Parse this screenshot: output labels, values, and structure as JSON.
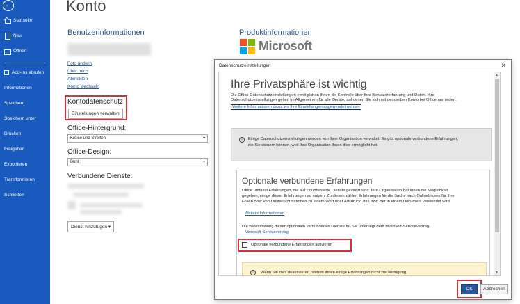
{
  "sidebar": {
    "items": [
      {
        "label": "Startseite",
        "icon": "home-icon"
      },
      {
        "label": "Neu",
        "icon": "new-document-icon"
      },
      {
        "label": "Öffnen",
        "icon": "open-folder-icon"
      },
      {
        "label": "Add-Ins abrufen"
      },
      {
        "label": "Informationen"
      },
      {
        "label": "Speichern"
      },
      {
        "label": "Speichern unter"
      },
      {
        "label": "Drucken"
      },
      {
        "label": "Freigeben"
      },
      {
        "label": "Exportieren"
      },
      {
        "label": "Transformieren"
      },
      {
        "label": "Schließen"
      }
    ],
    "back_icon": "←"
  },
  "page": {
    "title": "Konto",
    "user_info_heading": "Benutzerinformationen",
    "links": [
      "Foto ändern",
      "Über mich",
      "Abmelden",
      "Konto wechseln"
    ],
    "privacy_heading": "Kontodatenschutz",
    "manage_settings_btn": "Einstellungen verwalten",
    "background_label": "Office-Hintergrund:",
    "background_value": "Kreise und Streifen",
    "design_label": "Office-Design:",
    "design_value": "Bunt",
    "services_label": "Verbundene Dienste:",
    "add_service_btn": "Dienst hinzufügen",
    "product_heading": "Produktinformationen",
    "microsoft_word": "Microsoft"
  },
  "colors": {
    "sidebar": "#185abd",
    "accent": "#2b579a",
    "highlight": "#d13438",
    "ms_red": "#f25022",
    "ms_green": "#7fba00",
    "ms_blue": "#00a4ef",
    "ms_yellow": "#ffb900"
  },
  "dialog": {
    "title": "Datenschutzeinstellungen",
    "close": "✕",
    "heading": "Ihre Privatsphäre ist wichtig",
    "intro_line1": "Die Office-Datenschutzeinstellungen ermöglichen Ihnen die Kontrolle über Ihre Benutzererfahrung und Daten. Ihre",
    "intro_line2": "Datenschutzeinstellungen gelten im Allgemeinen für alle Geräte, auf denen Sie sich mit demselben Konto bei Office anmelden.",
    "more_info_link": "Weitere Informationen dazu, wo Ihre Einstellungen angewendet werden",
    "info_line1": "Einige Datenschutzeinstellungen werden von Ihrer Organisation verwaltet. Es gibt optionale verbundene Erfahrungen,",
    "info_line2": "die Sie steuern können, weil Ihre Organisation Ihnen dies ermöglicht hat.",
    "optional_heading": "Optionale verbundene Erfahrungen",
    "opt_line1": "Office umfasst Erfahrungen, die auf cloudbasierte Dienste gestützt sind. Ihre Organisation hat Ihnen die Möglichkeit",
    "opt_line2": "gegeben, einige dieser Erfahrungen zu nutzen. Zu diesen zählen Erfahrungen für die Suche nach Onlinebildern für Ihre",
    "opt_line3": "Folien oder von Onlineinformationen zu einem Wort oder Ausdruck, das bzw. der in einem Dokument verwendet wird.",
    "opt_more_link": "Weitere Informationen",
    "contract_line": "Die Bereitstellung dieser optionalen verbundenen Dienste für Sie unterliegt dem Microsoft-Servicevertrag.",
    "contract_link": "Microsoft-Servicevertrag",
    "checkbox_label": "Optionale verbundene Erfahrungen aktivieren",
    "checkbox_checked": false,
    "warn_text": "Wenn Sie dies deaktivieren, stehen Ihnen einige Erfahrungen nicht zur Verfügung.",
    "ok": "OK",
    "cancel": "Abbrechen"
  }
}
